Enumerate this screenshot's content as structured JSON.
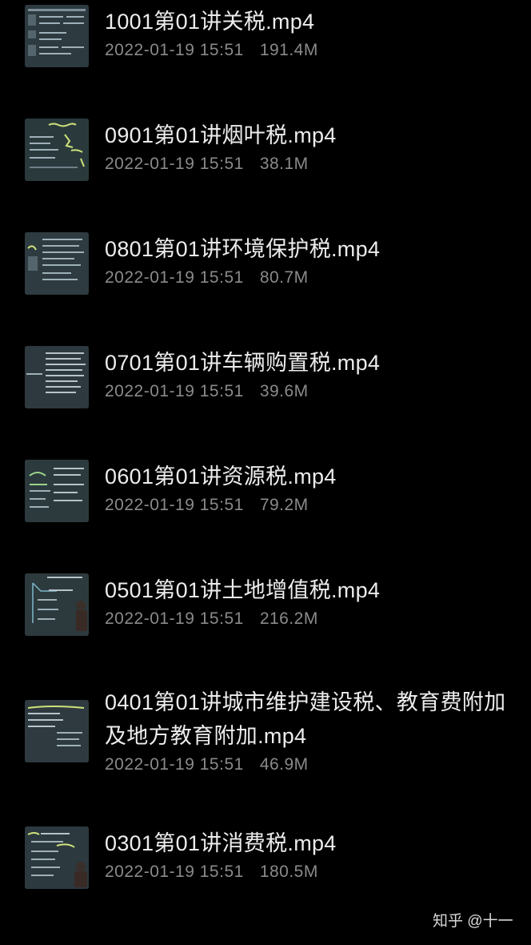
{
  "files": [
    {
      "name": "1001第01讲关税.mp4",
      "date": "2022-01-19 15:51",
      "size": "191.4M",
      "thumbnail": "video-thumbnail-icon"
    },
    {
      "name": "0901第01讲烟叶税.mp4",
      "date": "2022-01-19 15:51",
      "size": "38.1M",
      "thumbnail": "video-thumbnail-icon"
    },
    {
      "name": "0801第01讲环境保护税.mp4",
      "date": "2022-01-19 15:51",
      "size": "80.7M",
      "thumbnail": "video-thumbnail-icon"
    },
    {
      "name": "0701第01讲车辆购置税.mp4",
      "date": "2022-01-19 15:51",
      "size": "39.6M",
      "thumbnail": "video-thumbnail-icon"
    },
    {
      "name": "0601第01讲资源税.mp4",
      "date": "2022-01-19 15:51",
      "size": "79.2M",
      "thumbnail": "video-thumbnail-icon"
    },
    {
      "name": "0501第01讲土地增值税.mp4",
      "date": "2022-01-19 15:51",
      "size": "216.2M",
      "thumbnail": "video-thumbnail-icon"
    },
    {
      "name": "0401第01讲城市维护建设税、教育费附加及地方教育附加.mp4",
      "date": "2022-01-19 15:51",
      "size": "46.9M",
      "thumbnail": "video-thumbnail-icon"
    },
    {
      "name": "0301第01讲消费税.mp4",
      "date": "2022-01-19 15:51",
      "size": "180.5M",
      "thumbnail": "video-thumbnail-icon"
    }
  ],
  "watermark": "知乎 @十一",
  "colors": {
    "background": "#000000",
    "file_name": "#ececec",
    "file_meta": "#8a8a8a",
    "thumbnail_bg": "#2d3a40"
  }
}
